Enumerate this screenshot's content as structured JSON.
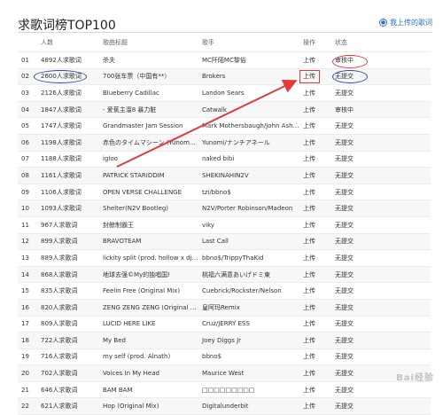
{
  "header": {
    "title": "求歌词榜TOP100",
    "upload_link": "我上传的歌词",
    "upload_icon": "person-icon"
  },
  "table": {
    "columns": [
      "人数",
      "歌曲标题",
      "歌手",
      "操作",
      "状态"
    ],
    "rows": [
      {
        "num": "01",
        "count": "4892人求歌词",
        "song": "杀夫",
        "artist": "MC阡陌MC黎俗",
        "op": "上传",
        "status": "审核中"
      },
      {
        "num": "02",
        "count": "2600人求歌词",
        "song": "700张车票（中国有**）",
        "artist": "Brokers",
        "op": "上传",
        "status": "无提交"
      },
      {
        "num": "03",
        "count": "2126人求歌词",
        "song": "Blueberry Cadillac",
        "artist": "Landon Sears",
        "op": "上传",
        "status": "无提交"
      },
      {
        "num": "04",
        "count": "1847人求歌词",
        "song": "- 爱蕉主溜8 暴力脏",
        "artist": "Catwalk",
        "op": "上传",
        "status": "审核中"
      },
      {
        "num": "05",
        "count": "1747人求歌词",
        "song": "Grandmaster Jam Session",
        "artist": "Mark Mothersbaugh/John Ashton ...",
        "op": "上传",
        "status": "无提交"
      },
      {
        "num": "06",
        "count": "1198人求歌词",
        "song": "赤色のタイムマシーン (Yunom...",
        "artist": "Yunomi/ナンチアネール",
        "op": "上传",
        "status": "无提交"
      },
      {
        "num": "07",
        "count": "1188人求歌词",
        "song": "igloo",
        "artist": "naked bibi",
        "op": "上传",
        "status": "无提交"
      },
      {
        "num": "08",
        "count": "1161人求歌词",
        "song": "PATRICK STARIDDIM",
        "artist": "SHEKINAHIN2V",
        "op": "上传",
        "status": "无提交"
      },
      {
        "num": "09",
        "count": "1106人求歌词",
        "song": "OPEN VERSE CHALLENGE",
        "artist": "tzi/bbno$",
        "op": "上传",
        "status": "无提交"
      },
      {
        "num": "10",
        "count": "1093人求歌词",
        "song": "Shelter(N2V Bootleg)",
        "artist": "N2V/Porter Robinson/Madeon",
        "op": "上传",
        "status": "无提交"
      },
      {
        "num": "11",
        "count": "967人求歌词",
        "song": "封鲸制霸王",
        "artist": "viky",
        "op": "上传",
        "status": "无提交"
      },
      {
        "num": "12",
        "count": "899人求歌词",
        "song": "BRAVOTEAM",
        "artist": "Last Call",
        "op": "上传",
        "status": "无提交"
      },
      {
        "num": "13",
        "count": "889人求歌词",
        "song": "lickity split (prod. hollow x dj patt)",
        "artist": "bbno$/TrippyThaKid",
        "op": "上传",
        "status": "无提交"
      },
      {
        "num": "14",
        "count": "868人求歌词",
        "song": "地球去强©My的独唱国!",
        "artist": "桃福六满意あいげドミ東",
        "op": "上传",
        "status": "无提交"
      },
      {
        "num": "15",
        "count": "835人求歌词",
        "song": "Feelin Free (Original Mix)",
        "artist": "Cuebrick/Rockster/Nelson",
        "op": "上传",
        "status": "无提交"
      },
      {
        "num": "16",
        "count": "820人求歌词",
        "song": "ZENG ZENG ZENG (Original Mix)",
        "artist": "皇阿玛Remix",
        "op": "上传",
        "status": "无提交"
      },
      {
        "num": "17",
        "count": "809人求歌词",
        "song": "LUCID HERE LIKE",
        "artist": "Cruz/JERRY ESS",
        "op": "上传",
        "status": "无提交"
      },
      {
        "num": "18",
        "count": "722人求歌词",
        "song": "My Bed",
        "artist": "Joey Diggs Jr",
        "op": "上传",
        "status": "无提交"
      },
      {
        "num": "19",
        "count": "716人求歌词",
        "song": "my self (prod. Alnath)",
        "artist": "bbno$",
        "op": "上传",
        "status": "无提交"
      },
      {
        "num": "20",
        "count": "702人求歌词",
        "song": "Voices In My Head",
        "artist": "Maurice West",
        "op": "上传",
        "status": "无提交"
      },
      {
        "num": "21",
        "count": "646人求歌词",
        "song": "BAM BAM",
        "artist": "□□□□□□□□□",
        "op": "上传",
        "status": "无提交"
      },
      {
        "num": "22",
        "count": "621人求歌词",
        "song": "Hop (Original Mix)",
        "artist": "Digitalunderbit",
        "op": "上传",
        "status": "无提交"
      }
    ]
  },
  "watermark": "Bai经验"
}
